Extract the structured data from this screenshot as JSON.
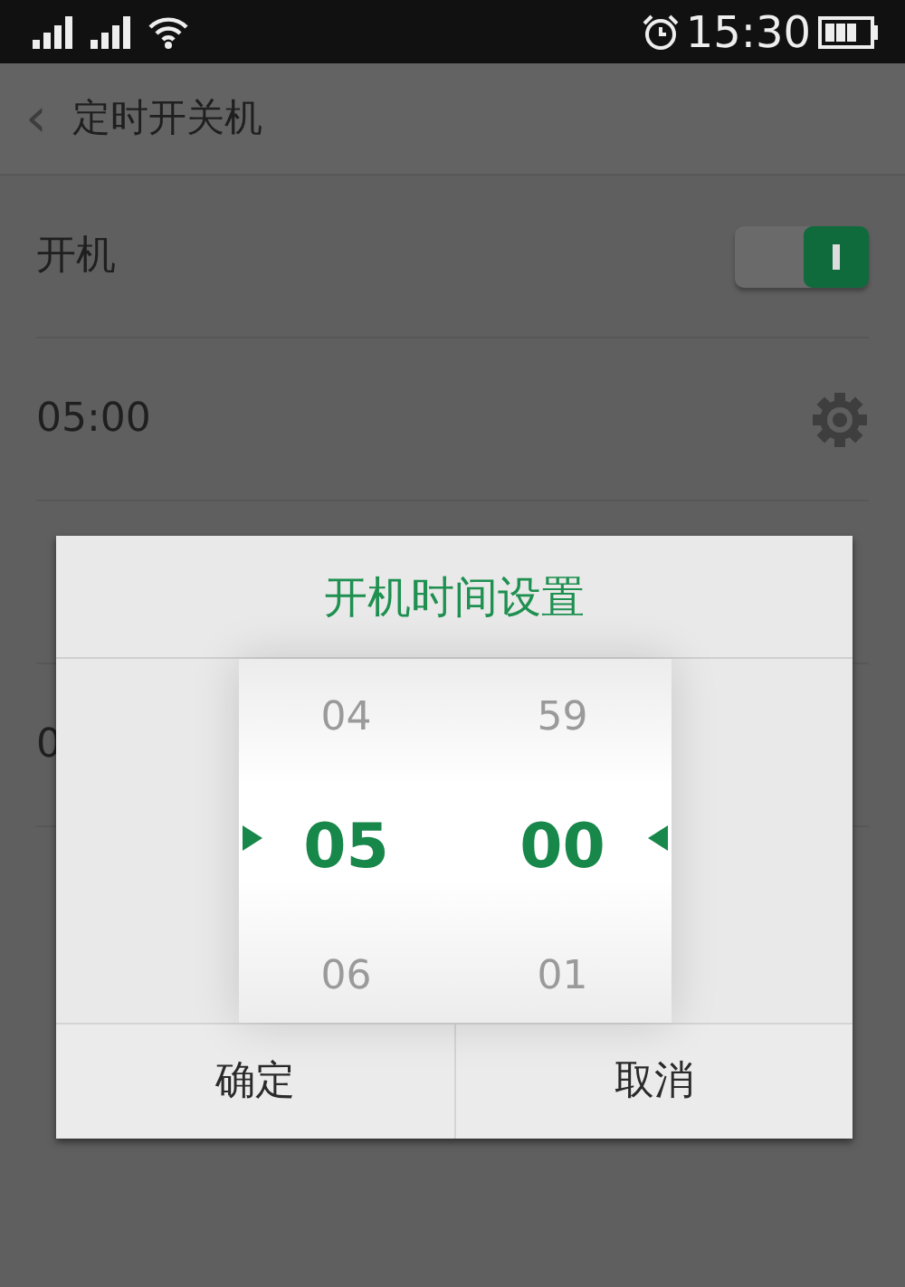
{
  "status_bar": {
    "time": "15:30"
  },
  "header": {
    "back": "‹",
    "title": "定时开关机"
  },
  "rows": [
    {
      "kind": "switch",
      "label": "开机",
      "on": true
    },
    {
      "kind": "time",
      "label": "05:00"
    },
    {
      "kind": "covered"
    },
    {
      "kind": "time",
      "label": "0"
    }
  ],
  "dialog": {
    "title": "开机时间设置",
    "columns": [
      {
        "items": [
          {
            "text": "04",
            "selected": false
          },
          {
            "text": "05",
            "selected": true
          },
          {
            "text": "06",
            "selected": false
          }
        ]
      },
      {
        "items": [
          {
            "text": "59",
            "selected": false
          },
          {
            "text": "00",
            "selected": true
          },
          {
            "text": "01",
            "selected": false
          }
        ]
      }
    ],
    "buttons": [
      "确定",
      "取消"
    ]
  }
}
